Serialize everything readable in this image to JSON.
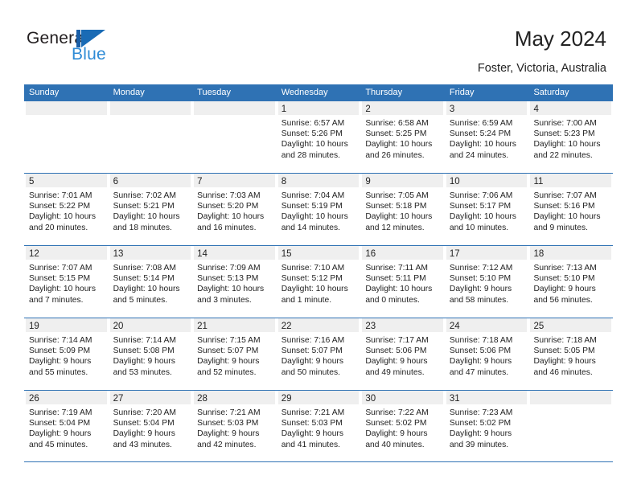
{
  "brand": {
    "name_top": "General",
    "name_bottom": "Blue",
    "mark": "triangle-logo",
    "color_dark": "#1A5FA8",
    "color_light": "#2E8BD6"
  },
  "header": {
    "title": "May 2024",
    "subtitle": "Foster, Victoria, Australia"
  },
  "theme": {
    "header_blue": "#2F72B4",
    "daynum_band": "#efefef",
    "text": "#222222"
  },
  "weekdays": [
    "Sunday",
    "Monday",
    "Tuesday",
    "Wednesday",
    "Thursday",
    "Friday",
    "Saturday"
  ],
  "weeks": [
    [
      {
        "day": "",
        "sunrise": "",
        "sunset": "",
        "daylight1": "",
        "daylight2": ""
      },
      {
        "day": "",
        "sunrise": "",
        "sunset": "",
        "daylight1": "",
        "daylight2": ""
      },
      {
        "day": "",
        "sunrise": "",
        "sunset": "",
        "daylight1": "",
        "daylight2": ""
      },
      {
        "day": "1",
        "sunrise": "Sunrise: 6:57 AM",
        "sunset": "Sunset: 5:26 PM",
        "daylight1": "Daylight: 10 hours",
        "daylight2": "and 28 minutes."
      },
      {
        "day": "2",
        "sunrise": "Sunrise: 6:58 AM",
        "sunset": "Sunset: 5:25 PM",
        "daylight1": "Daylight: 10 hours",
        "daylight2": "and 26 minutes."
      },
      {
        "day": "3",
        "sunrise": "Sunrise: 6:59 AM",
        "sunset": "Sunset: 5:24 PM",
        "daylight1": "Daylight: 10 hours",
        "daylight2": "and 24 minutes."
      },
      {
        "day": "4",
        "sunrise": "Sunrise: 7:00 AM",
        "sunset": "Sunset: 5:23 PM",
        "daylight1": "Daylight: 10 hours",
        "daylight2": "and 22 minutes."
      }
    ],
    [
      {
        "day": "5",
        "sunrise": "Sunrise: 7:01 AM",
        "sunset": "Sunset: 5:22 PM",
        "daylight1": "Daylight: 10 hours",
        "daylight2": "and 20 minutes."
      },
      {
        "day": "6",
        "sunrise": "Sunrise: 7:02 AM",
        "sunset": "Sunset: 5:21 PM",
        "daylight1": "Daylight: 10 hours",
        "daylight2": "and 18 minutes."
      },
      {
        "day": "7",
        "sunrise": "Sunrise: 7:03 AM",
        "sunset": "Sunset: 5:20 PM",
        "daylight1": "Daylight: 10 hours",
        "daylight2": "and 16 minutes."
      },
      {
        "day": "8",
        "sunrise": "Sunrise: 7:04 AM",
        "sunset": "Sunset: 5:19 PM",
        "daylight1": "Daylight: 10 hours",
        "daylight2": "and 14 minutes."
      },
      {
        "day": "9",
        "sunrise": "Sunrise: 7:05 AM",
        "sunset": "Sunset: 5:18 PM",
        "daylight1": "Daylight: 10 hours",
        "daylight2": "and 12 minutes."
      },
      {
        "day": "10",
        "sunrise": "Sunrise: 7:06 AM",
        "sunset": "Sunset: 5:17 PM",
        "daylight1": "Daylight: 10 hours",
        "daylight2": "and 10 minutes."
      },
      {
        "day": "11",
        "sunrise": "Sunrise: 7:07 AM",
        "sunset": "Sunset: 5:16 PM",
        "daylight1": "Daylight: 10 hours",
        "daylight2": "and 9 minutes."
      }
    ],
    [
      {
        "day": "12",
        "sunrise": "Sunrise: 7:07 AM",
        "sunset": "Sunset: 5:15 PM",
        "daylight1": "Daylight: 10 hours",
        "daylight2": "and 7 minutes."
      },
      {
        "day": "13",
        "sunrise": "Sunrise: 7:08 AM",
        "sunset": "Sunset: 5:14 PM",
        "daylight1": "Daylight: 10 hours",
        "daylight2": "and 5 minutes."
      },
      {
        "day": "14",
        "sunrise": "Sunrise: 7:09 AM",
        "sunset": "Sunset: 5:13 PM",
        "daylight1": "Daylight: 10 hours",
        "daylight2": "and 3 minutes."
      },
      {
        "day": "15",
        "sunrise": "Sunrise: 7:10 AM",
        "sunset": "Sunset: 5:12 PM",
        "daylight1": "Daylight: 10 hours",
        "daylight2": "and 1 minute."
      },
      {
        "day": "16",
        "sunrise": "Sunrise: 7:11 AM",
        "sunset": "Sunset: 5:11 PM",
        "daylight1": "Daylight: 10 hours",
        "daylight2": "and 0 minutes."
      },
      {
        "day": "17",
        "sunrise": "Sunrise: 7:12 AM",
        "sunset": "Sunset: 5:10 PM",
        "daylight1": "Daylight: 9 hours",
        "daylight2": "and 58 minutes."
      },
      {
        "day": "18",
        "sunrise": "Sunrise: 7:13 AM",
        "sunset": "Sunset: 5:10 PM",
        "daylight1": "Daylight: 9 hours",
        "daylight2": "and 56 minutes."
      }
    ],
    [
      {
        "day": "19",
        "sunrise": "Sunrise: 7:14 AM",
        "sunset": "Sunset: 5:09 PM",
        "daylight1": "Daylight: 9 hours",
        "daylight2": "and 55 minutes."
      },
      {
        "day": "20",
        "sunrise": "Sunrise: 7:14 AM",
        "sunset": "Sunset: 5:08 PM",
        "daylight1": "Daylight: 9 hours",
        "daylight2": "and 53 minutes."
      },
      {
        "day": "21",
        "sunrise": "Sunrise: 7:15 AM",
        "sunset": "Sunset: 5:07 PM",
        "daylight1": "Daylight: 9 hours",
        "daylight2": "and 52 minutes."
      },
      {
        "day": "22",
        "sunrise": "Sunrise: 7:16 AM",
        "sunset": "Sunset: 5:07 PM",
        "daylight1": "Daylight: 9 hours",
        "daylight2": "and 50 minutes."
      },
      {
        "day": "23",
        "sunrise": "Sunrise: 7:17 AM",
        "sunset": "Sunset: 5:06 PM",
        "daylight1": "Daylight: 9 hours",
        "daylight2": "and 49 minutes."
      },
      {
        "day": "24",
        "sunrise": "Sunrise: 7:18 AM",
        "sunset": "Sunset: 5:06 PM",
        "daylight1": "Daylight: 9 hours",
        "daylight2": "and 47 minutes."
      },
      {
        "day": "25",
        "sunrise": "Sunrise: 7:18 AM",
        "sunset": "Sunset: 5:05 PM",
        "daylight1": "Daylight: 9 hours",
        "daylight2": "and 46 minutes."
      }
    ],
    [
      {
        "day": "26",
        "sunrise": "Sunrise: 7:19 AM",
        "sunset": "Sunset: 5:04 PM",
        "daylight1": "Daylight: 9 hours",
        "daylight2": "and 45 minutes."
      },
      {
        "day": "27",
        "sunrise": "Sunrise: 7:20 AM",
        "sunset": "Sunset: 5:04 PM",
        "daylight1": "Daylight: 9 hours",
        "daylight2": "and 43 minutes."
      },
      {
        "day": "28",
        "sunrise": "Sunrise: 7:21 AM",
        "sunset": "Sunset: 5:03 PM",
        "daylight1": "Daylight: 9 hours",
        "daylight2": "and 42 minutes."
      },
      {
        "day": "29",
        "sunrise": "Sunrise: 7:21 AM",
        "sunset": "Sunset: 5:03 PM",
        "daylight1": "Daylight: 9 hours",
        "daylight2": "and 41 minutes."
      },
      {
        "day": "30",
        "sunrise": "Sunrise: 7:22 AM",
        "sunset": "Sunset: 5:02 PM",
        "daylight1": "Daylight: 9 hours",
        "daylight2": "and 40 minutes."
      },
      {
        "day": "31",
        "sunrise": "Sunrise: 7:23 AM",
        "sunset": "Sunset: 5:02 PM",
        "daylight1": "Daylight: 9 hours",
        "daylight2": "and 39 minutes."
      },
      {
        "day": "",
        "sunrise": "",
        "sunset": "",
        "daylight1": "",
        "daylight2": ""
      }
    ]
  ]
}
